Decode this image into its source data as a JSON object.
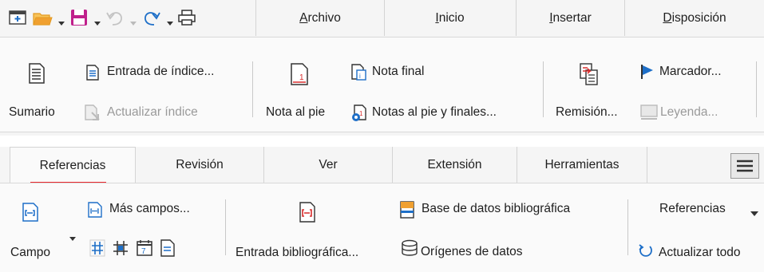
{
  "top_tabs": [
    "Archivo",
    "Inicio",
    "Insertar",
    "Disposición"
  ],
  "top_tab_accel": [
    "A",
    "I",
    "I",
    "D"
  ],
  "ribbon1": {
    "sumario": "Sumario",
    "entrada_indice": "Entrada de índice...",
    "actualizar_indice": "Actualizar índice",
    "nota_al_pie": "Nota al pie",
    "nota_final": "Nota final",
    "notas_pie_finales": "Notas al pie y finales...",
    "remision": "Remisión...",
    "marcador": "Marcador...",
    "leyenda": "Leyenda..."
  },
  "bottom_tabs": [
    "Referencias",
    "Revisión",
    "Ver",
    "Extensión",
    "Herramientas"
  ],
  "ribbon2": {
    "campo": "Campo",
    "mas_campos": "Más campos...",
    "entrada_bibliografica": "Entrada bibliográfica...",
    "base_datos": "Base de datos bibliográfica",
    "origenes_datos": "Orígenes de datos",
    "referencias_dropdown": "Referencias",
    "actualizar_todo": "Actualizar todo"
  },
  "colors": {
    "accent_red": "#e8282d",
    "icon_blue": "#1e6fc8",
    "icon_red": "#d92c2c",
    "folder_orange": "#f0a030",
    "save_magenta": "#c0208c"
  }
}
